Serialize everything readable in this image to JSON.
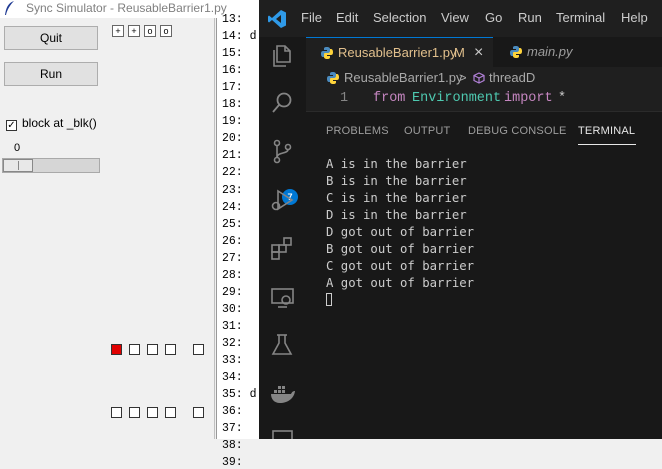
{
  "tk": {
    "title": "Sync Simulator - ReusableBarrier1.py",
    "quit_label": "Quit",
    "run_label": "Run",
    "block_label": "block at _blk()",
    "block_checked": true,
    "check_mark": "✓",
    "scale_value": "0",
    "mini_buttons": [
      "+",
      "+",
      "o",
      "o"
    ],
    "red_color": "#e00000",
    "line_numbers": [
      "13:",
      "14:",
      "15:",
      "16:",
      "17:",
      "18:",
      "19:",
      "20:",
      "21:",
      "22:",
      "23:",
      "24:",
      "25:",
      "26:",
      "27:",
      "28:",
      "29:",
      "30:",
      "31:",
      "32:",
      "33:",
      "34:",
      "35:",
      "36:",
      "37:",
      "38:",
      "39:"
    ],
    "code_fragments": {
      "14": "d",
      "35": "d"
    }
  },
  "vscode": {
    "menu": [
      "File",
      "Edit",
      "Selection",
      "View",
      "Go",
      "Run",
      "Terminal",
      "Help"
    ],
    "tabs": [
      {
        "label": "ReusableBarrier1.py",
        "modified": "M",
        "close": "×"
      },
      {
        "label": "main.py"
      }
    ],
    "breadcrumb": {
      "file": "ReusableBarrier1.py",
      "separator": ">",
      "symbol": "threadD"
    },
    "editor_line": {
      "number": "1",
      "kw1": "from",
      "module": "Environment",
      "kw2": "import",
      "rest": "*"
    },
    "panel_tabs": [
      "PROBLEMS",
      "OUTPUT",
      "DEBUG CONSOLE",
      "TERMINAL"
    ],
    "active_panel_tab": "TERMINAL",
    "scm_badge": "7",
    "terminal_lines": [
      "A is in the barrier",
      "B is in the barrier",
      "C is in the barrier",
      "D is in the barrier",
      "D got out of barrier",
      "B got out of barrier",
      "C got out of barrier",
      "A got out of barrier"
    ],
    "colors": {
      "accent": "#0078d4",
      "modified_tab": "#e2c08d",
      "keyword": "#c586c0",
      "module": "#4ec9b0"
    }
  }
}
